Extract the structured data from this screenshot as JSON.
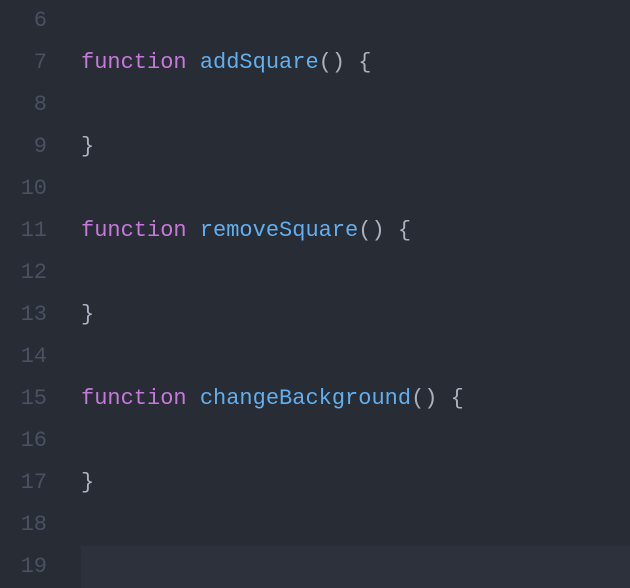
{
  "lines": [
    {
      "num": "6",
      "tokens": []
    },
    {
      "num": "7",
      "tokens": [
        {
          "t": "function",
          "c": "kw"
        },
        {
          "t": " ",
          "c": ""
        },
        {
          "t": "addSquare",
          "c": "fn"
        },
        {
          "t": "()",
          "c": "punct"
        },
        {
          "t": " ",
          "c": ""
        },
        {
          "t": "{",
          "c": "brace"
        }
      ]
    },
    {
      "num": "8",
      "tokens": []
    },
    {
      "num": "9",
      "tokens": [
        {
          "t": "}",
          "c": "brace"
        }
      ]
    },
    {
      "num": "10",
      "tokens": []
    },
    {
      "num": "11",
      "tokens": [
        {
          "t": "function",
          "c": "kw"
        },
        {
          "t": " ",
          "c": ""
        },
        {
          "t": "removeSquare",
          "c": "fn"
        },
        {
          "t": "()",
          "c": "punct"
        },
        {
          "t": " ",
          "c": ""
        },
        {
          "t": "{",
          "c": "brace"
        }
      ]
    },
    {
      "num": "12",
      "tokens": []
    },
    {
      "num": "13",
      "tokens": [
        {
          "t": "}",
          "c": "brace"
        }
      ]
    },
    {
      "num": "14",
      "tokens": []
    },
    {
      "num": "15",
      "tokens": [
        {
          "t": "function",
          "c": "kw"
        },
        {
          "t": " ",
          "c": ""
        },
        {
          "t": "changeBackground",
          "c": "fn"
        },
        {
          "t": "()",
          "c": "punct"
        },
        {
          "t": " ",
          "c": ""
        },
        {
          "t": "{",
          "c": "brace"
        }
      ]
    },
    {
      "num": "16",
      "tokens": []
    },
    {
      "num": "17",
      "tokens": [
        {
          "t": "}",
          "c": "brace"
        }
      ]
    },
    {
      "num": "18",
      "tokens": []
    },
    {
      "num": "19",
      "tokens": [],
      "current": true
    }
  ]
}
